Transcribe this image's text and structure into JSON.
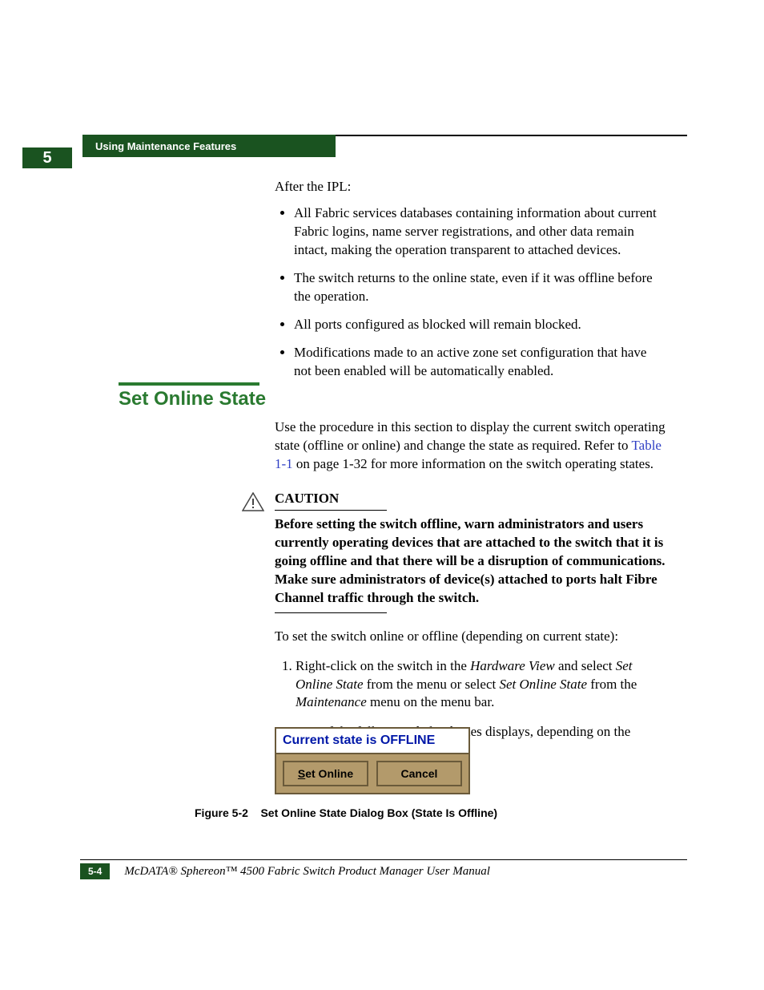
{
  "header": {
    "tab_label": "Using Maintenance Features",
    "chapter_number": "5"
  },
  "intro": {
    "after_ipl": "After the IPL:",
    "bullets": [
      "All Fabric services databases containing information about current Fabric logins, name server registrations, and other data remain intact, making the operation transparent to attached devices.",
      "The switch returns to the online state, even if it was offline before the operation.",
      "All ports configured as blocked will remain blocked.",
      "Modifications made to an active zone set configuration that have not been enabled will be automatically enabled."
    ]
  },
  "section": {
    "heading": "Set Online State",
    "para_pre": "Use the procedure in this section to display the current switch operating state (offline or online) and change the state as required. Refer to ",
    "ref_link": "Table 1-1",
    "para_post": " on page 1-32 for more information on the switch operating states."
  },
  "caution": {
    "label": "CAUTION",
    "text": "Before setting the switch offline, warn administrators and users currently operating devices that are attached to the switch that it is going offline and that there will be a disruption of communications. Make sure administrators of device(s) attached to ports halt Fibre Channel traffic through the switch."
  },
  "procedure": {
    "intro": "To set the switch online or offline (depending on current state):",
    "step1_pre": "Right-click on the switch in the ",
    "step1_em1": "Hardware View",
    "step1_mid1": " and select ",
    "step1_em2": "Set Online State",
    "step1_mid2": " from the menu or select ",
    "step1_em3": "Set Online State",
    "step1_mid3": " from the ",
    "step1_em4": "Maintenance",
    "step1_post": " menu on the menu bar.",
    "step1_result": "One of the following dialog boxes displays, depending on the current operating state."
  },
  "dialog": {
    "title": "Current state is OFFLINE",
    "set_online_mnemonic": "S",
    "set_online_rest": "et Online",
    "cancel": "Cancel"
  },
  "figure": {
    "label": "Figure 5-2",
    "caption": "Set Online State Dialog Box (State Is Offline)"
  },
  "footer": {
    "page_num": "5-4",
    "manual": "McDATA® Sphereon™ 4500 Fabric Switch  Product Manager User Manual"
  }
}
